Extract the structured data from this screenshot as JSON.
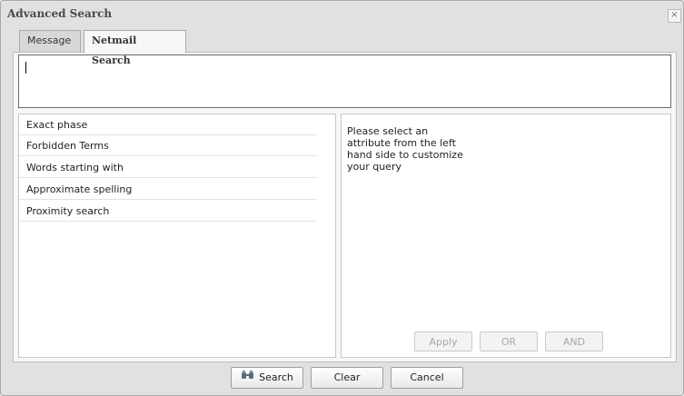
{
  "dialog": {
    "title": "Advanced Search",
    "close_glyph": "×"
  },
  "tabs": [
    {
      "label": "Message",
      "active": false
    },
    {
      "label": "Netmail Search",
      "active": true
    }
  ],
  "query_box": {
    "value": ""
  },
  "attributes": [
    {
      "label": "Exact phase"
    },
    {
      "label": "Forbidden Terms"
    },
    {
      "label": "Words starting with"
    },
    {
      "label": "Approximate spelling"
    },
    {
      "label": "Proximity search"
    }
  ],
  "help": {
    "line1": "Please select an",
    "line2": "attribute from the left",
    "line3": "hand side to customize",
    "line4": "your query"
  },
  "operators": {
    "apply": "Apply",
    "or": "OR",
    "and": "AND"
  },
  "footer": {
    "search": "Search",
    "clear": "Clear",
    "cancel": "Cancel"
  },
  "icons": {
    "search_button": "binoculars-icon",
    "close": "close-icon"
  }
}
